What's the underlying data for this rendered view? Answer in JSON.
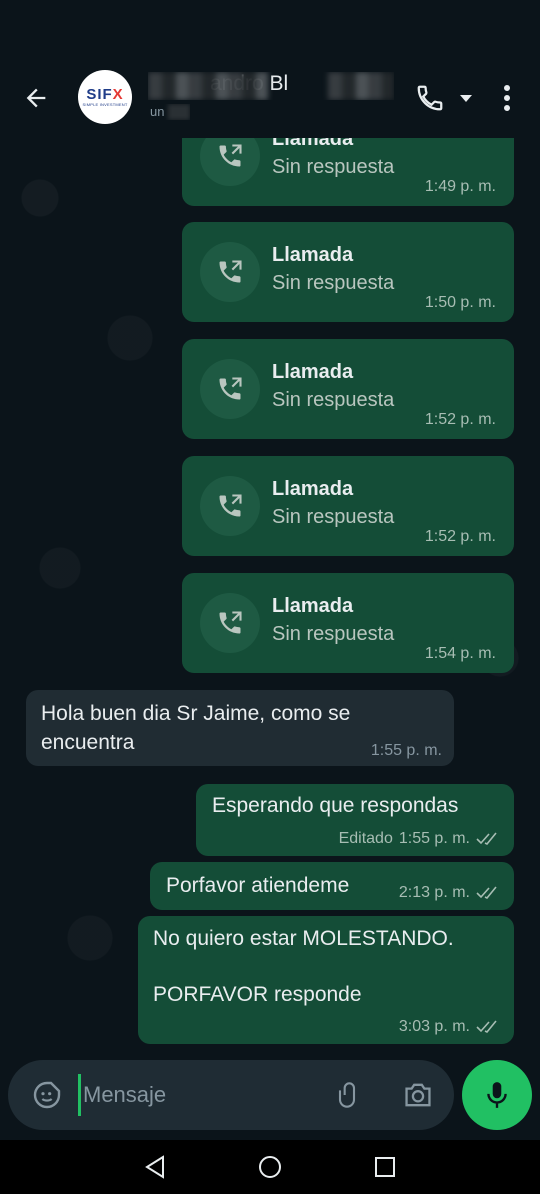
{
  "header": {
    "avatar_logo": "SIFX",
    "avatar_tagline": "SIMPLE INVESTMENT",
    "contact_name": "andro Bl",
    "contact_subtitle": "un",
    "icons": {
      "back": "arrow-left-icon",
      "call": "phone-icon",
      "caret": "caret-down-icon",
      "menu": "more-vertical-icon"
    }
  },
  "calls": [
    {
      "title": "Llamada",
      "status": "Sin respuesta",
      "time": "1:49 p. m."
    },
    {
      "title": "Llamada",
      "status": "Sin respuesta",
      "time": "1:50 p. m."
    },
    {
      "title": "Llamada",
      "status": "Sin respuesta",
      "time": "1:52 p. m."
    },
    {
      "title": "Llamada",
      "status": "Sin respuesta",
      "time": "1:52 p. m."
    },
    {
      "title": "Llamada",
      "status": "Sin respuesta",
      "time": "1:54 p. m."
    }
  ],
  "messages": [
    {
      "direction": "in",
      "lines": [
        "Hola buen dia Sr Jaime, como se",
        "encuentra"
      ],
      "time": "1:55 p. m."
    },
    {
      "direction": "out",
      "lines": [
        "Esperando que respondas"
      ],
      "edited_label": "Editado",
      "time": "1:55 p. m.",
      "status": "read"
    },
    {
      "direction": "out",
      "lines": [
        "Porfavor atiendeme"
      ],
      "time": "2:13 p. m.",
      "status": "read"
    },
    {
      "direction": "out",
      "lines": [
        "No quiero estar MOLESTANDO.",
        "PORFAVOR responde"
      ],
      "time": "3:03 p. m.",
      "status": "read"
    }
  ],
  "composer": {
    "placeholder": "Mensaje",
    "icons": {
      "emoji": "sticker-smile-icon",
      "attach": "paperclip-icon",
      "camera": "camera-icon",
      "mic": "microphone-icon"
    }
  },
  "colors": {
    "background": "#0b141a",
    "outgoing_bubble": "#144d37",
    "incoming_bubble": "#202c33",
    "accent": "#21c063",
    "read_ticks": "#a7bdb3"
  }
}
